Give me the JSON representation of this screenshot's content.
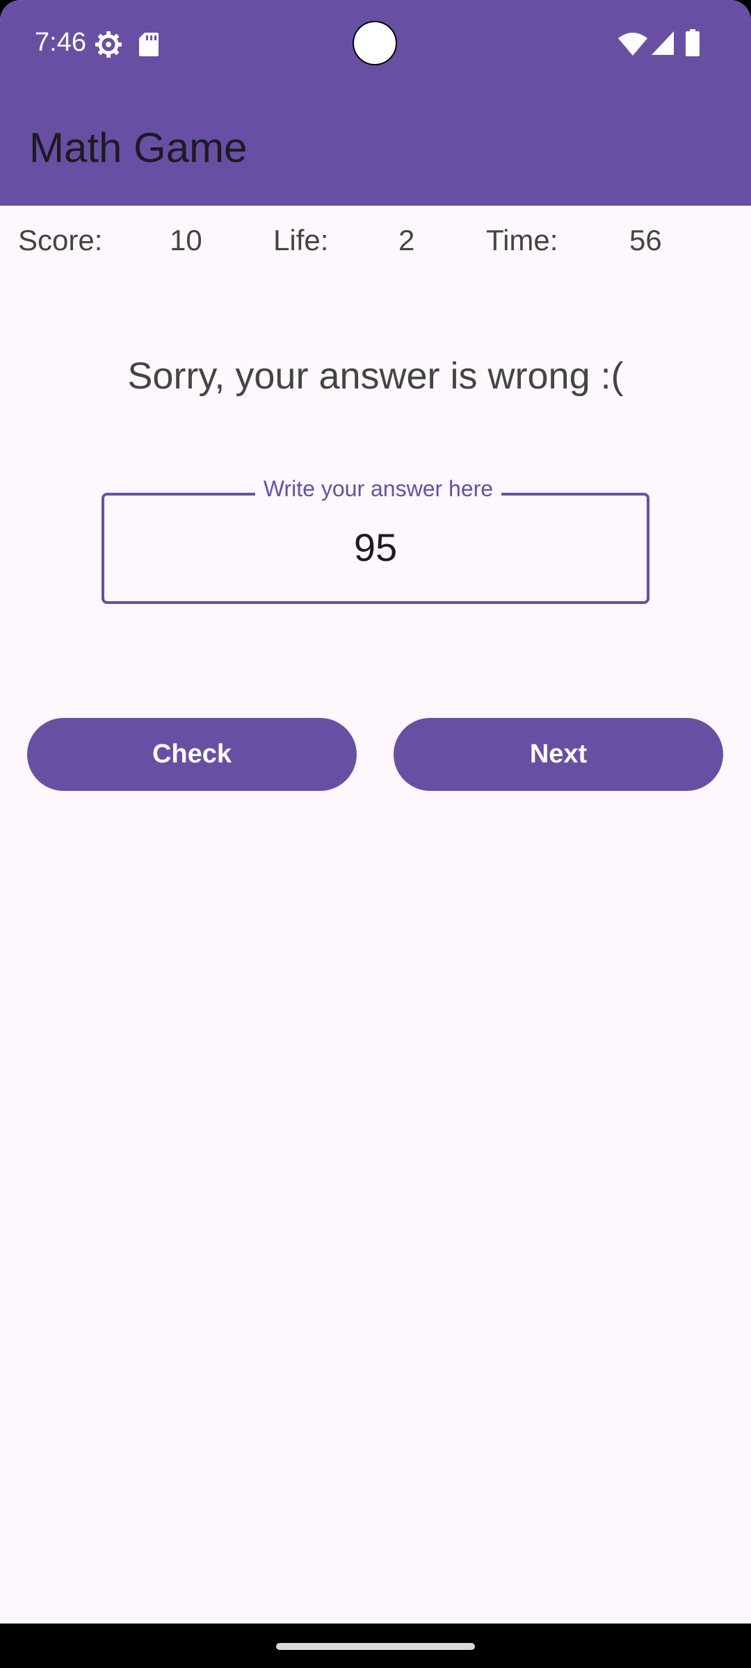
{
  "status_bar": {
    "time": "7:46",
    "left_icons": [
      "settings-icon",
      "sd-card-icon"
    ],
    "right_icons": [
      "wifi-icon",
      "cellular-signal-icon",
      "battery-icon"
    ]
  },
  "app_bar": {
    "title": "Math Game"
  },
  "stats": {
    "score_label": "Score:",
    "score_value": "10",
    "life_label": "Life:",
    "life_value": "2",
    "time_label": "Time:",
    "time_value": "56"
  },
  "message": "Sorry, your answer is wrong :(",
  "answer_field": {
    "label": "Write your answer here",
    "value": "95"
  },
  "buttons": {
    "check_label": "Check",
    "next_label": "Next"
  },
  "colors": {
    "primary": "#6750A4",
    "background": "#FEF7FD",
    "on_primary": "#FFFFFF",
    "text": "#444444"
  }
}
